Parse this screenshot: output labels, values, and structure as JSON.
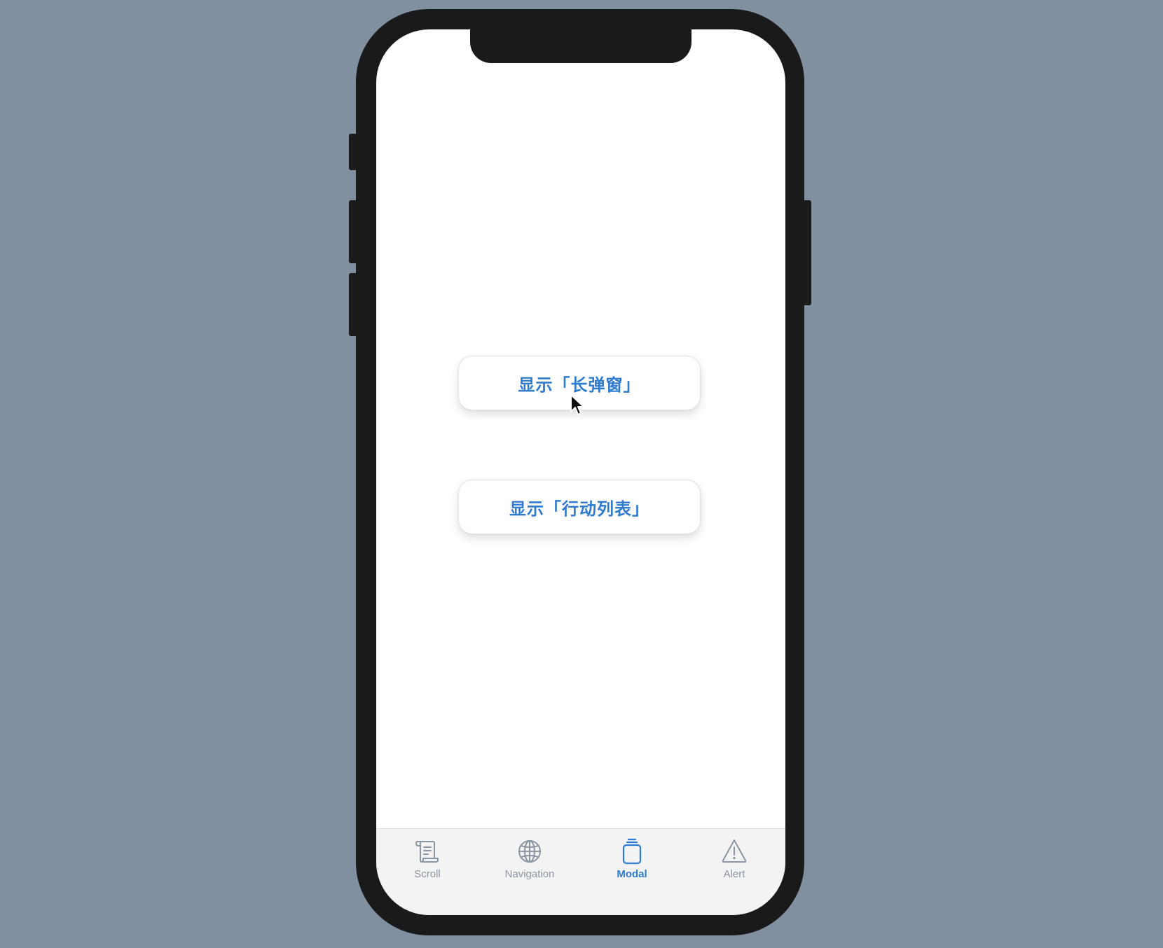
{
  "content": {
    "buttons": [
      {
        "label": "显示「长弹窗」"
      },
      {
        "label": "显示「行动列表」"
      }
    ]
  },
  "tabbar": {
    "accent_color": "#2f7bd0",
    "inactive_color": "#8b95a1",
    "items": [
      {
        "label": "Scroll",
        "icon": "scroll-icon",
        "active": false
      },
      {
        "label": "Navigation",
        "icon": "globe-icon",
        "active": false
      },
      {
        "label": "Modal",
        "icon": "stacked-card-icon",
        "active": true
      },
      {
        "label": "Alert",
        "icon": "warning-triangle-icon",
        "active": false
      }
    ]
  }
}
